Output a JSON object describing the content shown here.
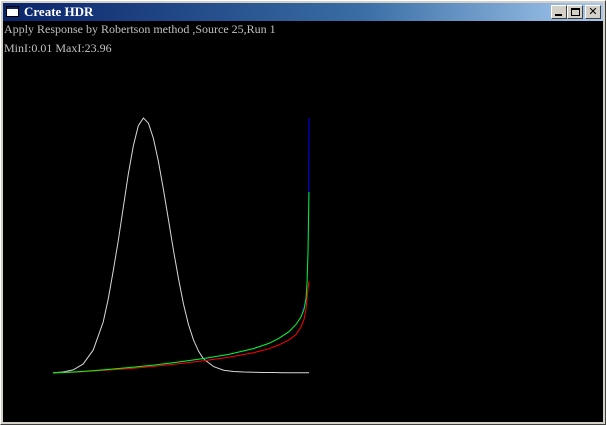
{
  "window": {
    "title": "Create HDR",
    "icon": "window-app-icon",
    "controls": {
      "minimize": "minimize-icon",
      "maximize": "maximize-icon",
      "close": "close-icon"
    }
  },
  "info": {
    "line1": "Apply Response by Robertson method ,Source 25,Run 1",
    "line2": "MinI:0.01 MaxI:23.96"
  },
  "colors": {
    "background": "#000000",
    "histogram": "#d8d8d8",
    "red": "#ff0000",
    "green": "#00ff00",
    "blue": "#0000ff",
    "text": "#c0c0c0"
  },
  "chart_data": {
    "type": "line",
    "title": "",
    "xlabel": "",
    "ylabel": "",
    "grid": false,
    "legend": "none",
    "series": [
      {
        "name": "",
        "color": "#d8d8d8",
        "x": [
          0,
          10,
          20,
          30,
          40,
          50,
          55,
          60,
          65,
          70,
          75,
          80,
          85,
          90,
          95,
          100,
          105,
          110,
          115,
          120,
          125,
          130,
          135,
          140,
          145,
          150,
          160,
          170,
          180,
          190,
          200,
          210,
          220,
          230,
          240,
          255
        ],
        "y": [
          0.001,
          0.004,
          0.012,
          0.035,
          0.09,
          0.2,
          0.29,
          0.4,
          0.52,
          0.65,
          0.78,
          0.89,
          0.97,
          1.0,
          0.98,
          0.92,
          0.83,
          0.72,
          0.6,
          0.48,
          0.37,
          0.27,
          0.19,
          0.13,
          0.085,
          0.055,
          0.025,
          0.011,
          0.006,
          0.004,
          0.003,
          0.002,
          0.002,
          0.001,
          0.001,
          0.001
        ]
      },
      {
        "name": "",
        "color": "#0000ff",
        "x": [
          0,
          25,
          50,
          75,
          100,
          125,
          150,
          175,
          200,
          215,
          225,
          235,
          242,
          247,
          250,
          252,
          253,
          254,
          254.6,
          255
        ],
        "y": [
          0.0,
          0.005,
          0.012,
          0.02,
          0.03,
          0.042,
          0.056,
          0.072,
          0.095,
          0.115,
          0.135,
          0.16,
          0.19,
          0.22,
          0.26,
          0.3,
          0.36,
          0.5,
          0.7,
          1.0
        ]
      },
      {
        "name": "",
        "color": "#ff0000",
        "x": [
          0,
          25,
          50,
          75,
          100,
          125,
          150,
          175,
          200,
          215,
          225,
          235,
          242,
          247,
          250,
          252,
          253,
          254,
          255
        ],
        "y": [
          0.0,
          0.004,
          0.01,
          0.017,
          0.026,
          0.036,
          0.048,
          0.062,
          0.08,
          0.095,
          0.11,
          0.13,
          0.15,
          0.18,
          0.21,
          0.25,
          0.29,
          0.33,
          0.36
        ]
      },
      {
        "name": "",
        "color": "#00ff00",
        "x": [
          0,
          25,
          50,
          75,
          100,
          125,
          150,
          175,
          200,
          215,
          225,
          235,
          242,
          247,
          250,
          252,
          253,
          254,
          254.6,
          255
        ],
        "y": [
          0.0,
          0.005,
          0.012,
          0.021,
          0.031,
          0.043,
          0.057,
          0.073,
          0.096,
          0.116,
          0.136,
          0.162,
          0.19,
          0.22,
          0.25,
          0.29,
          0.35,
          0.47,
          0.62,
          0.71
        ]
      }
    ]
  }
}
